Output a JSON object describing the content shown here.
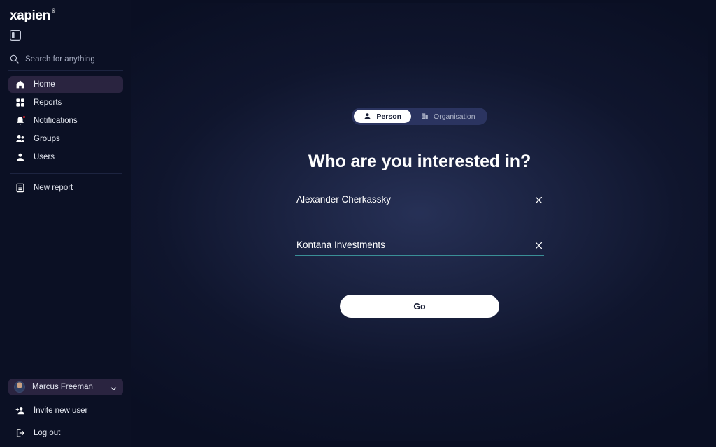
{
  "brand": {
    "name": "xapien",
    "trademark": "®"
  },
  "sidebar": {
    "panel_toggle_icon": "panel-collapse-icon",
    "search": {
      "placeholder": "Search for anything",
      "value": "",
      "icon": "search-icon"
    },
    "nav": [
      {
        "label": "Home",
        "icon": "home-icon",
        "active": true,
        "badge": false
      },
      {
        "label": "Reports",
        "icon": "grid-icon",
        "active": false,
        "badge": false
      },
      {
        "label": "Notifications",
        "icon": "bell-icon",
        "active": false,
        "badge": true
      },
      {
        "label": "Groups",
        "icon": "users-group-icon",
        "active": false,
        "badge": false
      },
      {
        "label": "Users",
        "icon": "user-icon",
        "active": false,
        "badge": false
      }
    ],
    "new_report": {
      "label": "New report",
      "icon": "document-list-icon"
    },
    "user": {
      "name": "Marcus Freeman",
      "avatar": "user-avatar",
      "chevron": "chevron-down-icon"
    },
    "footer": [
      {
        "label": "Invite new user",
        "icon": "user-plus-icon"
      },
      {
        "label": "Log out",
        "icon": "logout-icon"
      }
    ]
  },
  "main": {
    "toggle": {
      "options": [
        {
          "label": "Person",
          "icon": "person-icon",
          "active": true
        },
        {
          "label": "Organisation",
          "icon": "building-icon",
          "active": false
        }
      ]
    },
    "headline": "Who are you interested in?",
    "fields": [
      {
        "value": "Alexander Cherkassky",
        "placeholder": "",
        "clear_icon": "close-icon"
      },
      {
        "value": "Kontana Investments",
        "placeholder": "",
        "clear_icon": "close-icon"
      }
    ],
    "submit": {
      "label": "Go"
    }
  },
  "colors": {
    "page_bg": "#0a0f23",
    "sidebar_bg": "#0b1024",
    "panel_bg": "#232c52",
    "accent_underline": "#3a8f96",
    "active_nav_bg": "#2a2440",
    "badge_red": "#e8262b",
    "button_white": "#ffffff"
  }
}
